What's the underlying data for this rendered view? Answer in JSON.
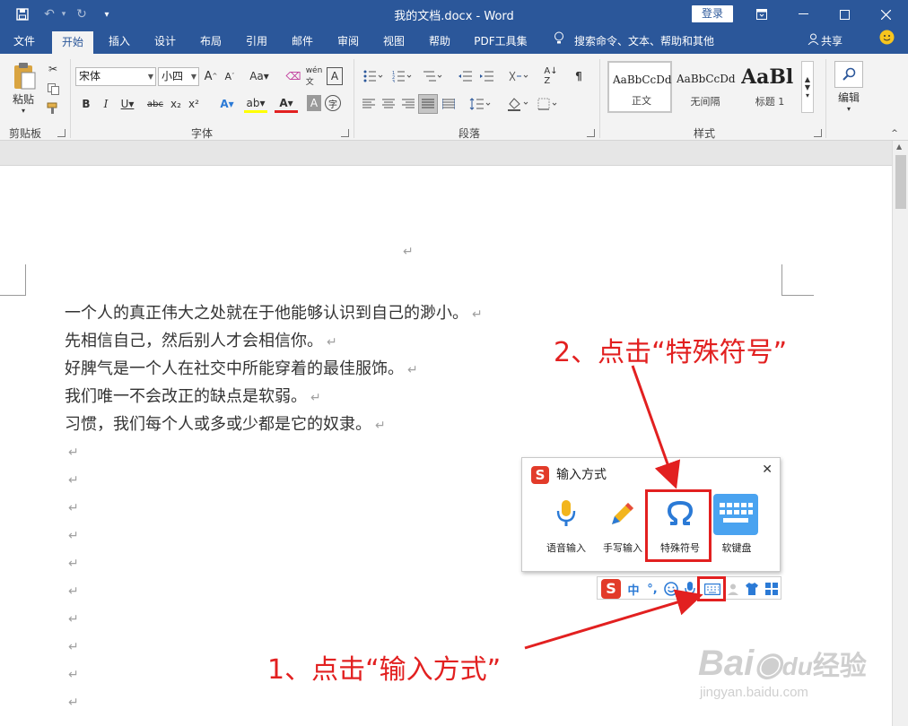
{
  "titlebar": {
    "title": "我的文档.docx  -  Word",
    "login": "登录"
  },
  "tabs": [
    "文件",
    "开始",
    "插入",
    "设计",
    "布局",
    "引用",
    "邮件",
    "审阅",
    "视图",
    "帮助",
    "PDF工具集"
  ],
  "tellme": "搜索命令、文本、帮助和其他",
  "share": "共享",
  "ribbon": {
    "paste_label": "粘贴",
    "clipboard_label": "剪贴板",
    "font_name": "宋体",
    "font_size": "小四",
    "font_label": "字体",
    "paragraph_label": "段落",
    "styles_label": "样式",
    "styles": [
      {
        "sample": "AaBbCcDd",
        "name": "正文"
      },
      {
        "sample": "AaBbCcDd",
        "name": "无间隔"
      },
      {
        "sample": "AaBl",
        "name": "标题 1"
      }
    ],
    "edit_label": "编辑"
  },
  "document": {
    "lines": [
      "一个人的真正伟大之处就在于他能够认识到自己的渺小。",
      "先相信自己，然后别人才会相信你。",
      "好脾气是一个人在社交中所能穿着的最佳服饰。",
      "我们唯一不会改正的缺点是软弱。",
      "习惯，我们每个人或多或少都是它的奴隶。"
    ],
    "para_mark": "↵"
  },
  "ime": {
    "title": "输入方式",
    "items": [
      "语音输入",
      "手写输入",
      "特殊符号",
      "软键盘"
    ],
    "toolbar_lang": "中"
  },
  "annotations": {
    "step1": "1、点击“输入方式”",
    "step2": "2、点击“特殊符号”"
  },
  "watermark": {
    "brand": "Bai",
    "brand_cn": "经验",
    "url": "jingyan.baidu.com"
  },
  "colors": {
    "word_blue": "#2b579a",
    "annotation_red": "#e22020",
    "ime_blue": "#2b7ad6"
  }
}
